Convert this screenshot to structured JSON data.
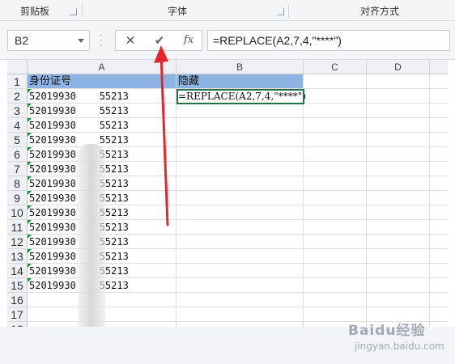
{
  "ribbon": {
    "groups": [
      "剪贴板",
      "字体",
      "对齐方式"
    ]
  },
  "formula_bar": {
    "name_box": "B2",
    "cancel_icon": "✕",
    "confirm_icon": "✔",
    "fx_label": "fx",
    "formula": "=REPLACE(A2,7,4,\"****\")"
  },
  "grid": {
    "columns": [
      "A",
      "B",
      "C",
      "D"
    ],
    "row_numbers": [
      "1",
      "2",
      "3",
      "4",
      "5",
      "6",
      "7",
      "8",
      "9",
      "10",
      "11",
      "12",
      "13",
      "14",
      "15",
      "16",
      "17",
      "18"
    ],
    "header_row": [
      "身份证号",
      "隐藏"
    ],
    "id_values": [
      "52019930    55213",
      "52019930    55213",
      "52019930    55213",
      "52019930    55213",
      "52019930    55213",
      "52019930    55213",
      "52019930    55213",
      "52019930    55213",
      "52019930    55213",
      "52019930    55213",
      "52019930    55213",
      "52019930    55213",
      "52019930    55213",
      "52019930    55213"
    ],
    "b2_display": "=REPLACE(A2,7,4,\"****\")",
    "header_color": "#8db3e2",
    "selection_color": "#217346"
  },
  "annotation": {
    "arrow_color": "#e8262a"
  },
  "watermark": {
    "brand": "Baidu",
    "suffix": "经验",
    "url": "jingyan.baidu.com"
  }
}
